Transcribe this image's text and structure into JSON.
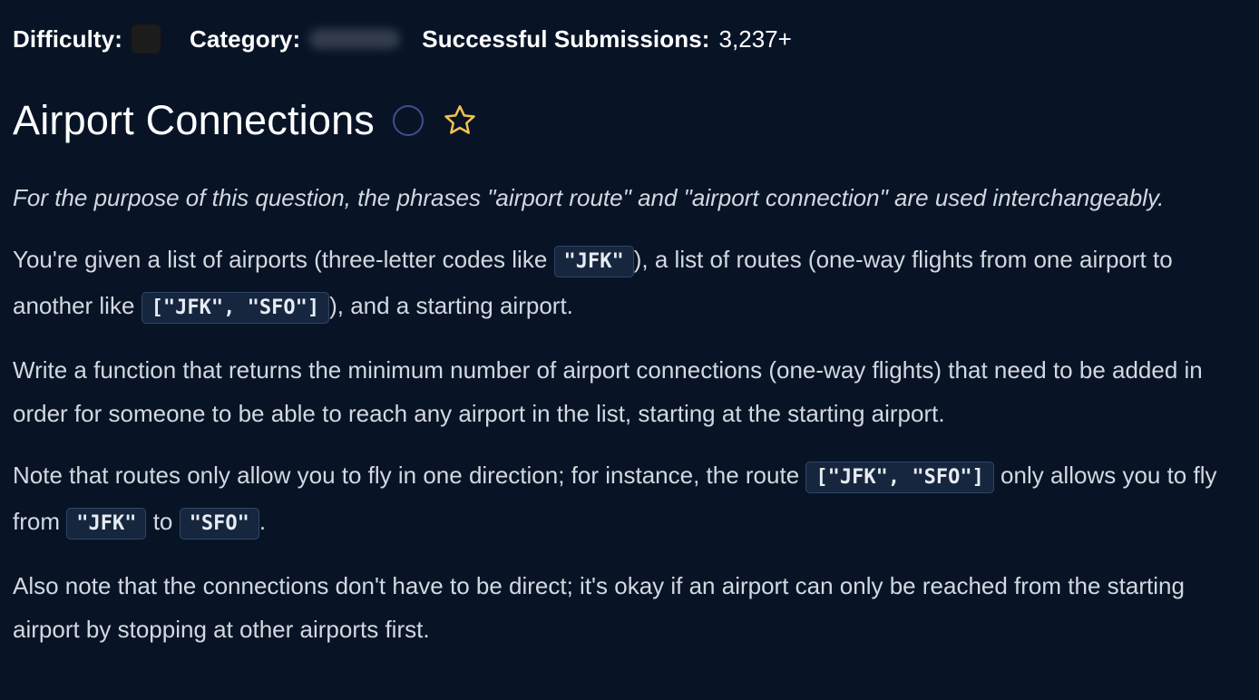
{
  "meta": {
    "difficulty_label": "Difficulty:",
    "category_label": "Category:",
    "submissions_label": "Successful Submissions:",
    "submissions_value": "3,237+"
  },
  "problem": {
    "title": "Airport Connections"
  },
  "description": {
    "intro_note": "For the purpose of this question, the phrases \"airport route\" and \"airport connection\" are used interchangeably.",
    "p1": {
      "t1": "You're given a list of airports (three-letter codes like ",
      "c1": "\"JFK\"",
      "t2": "), a list of routes (one-way flights from one airport to another like ",
      "c2": "[\"JFK\", \"SFO\"]",
      "t3": "), and a starting airport."
    },
    "p2": "Write a function that returns the minimum number of airport connections (one-way flights) that need to be added in order for someone to be able to reach any airport in the list, starting at the starting airport.",
    "p3": {
      "t1": "Note that routes only allow you to fly in one direction; for instance, the route ",
      "c1": "[\"JFK\", \"SFO\"]",
      "t2": " only allows you to fly from ",
      "c2": "\"JFK\"",
      "t3": " to ",
      "c3": "\"SFO\"",
      "t4": "."
    },
    "p4": "Also note that the connections don't have to be direct; it's okay if an airport can only be reached from the starting airport by stopping at other airports first."
  },
  "colors": {
    "background": "#081426",
    "code_background": "#16263f",
    "star_outline": "#f2c34e",
    "status_circle": "#3f4f8c"
  },
  "icons": {
    "status": "circle-outline-icon",
    "favorite": "star-outline-icon"
  }
}
